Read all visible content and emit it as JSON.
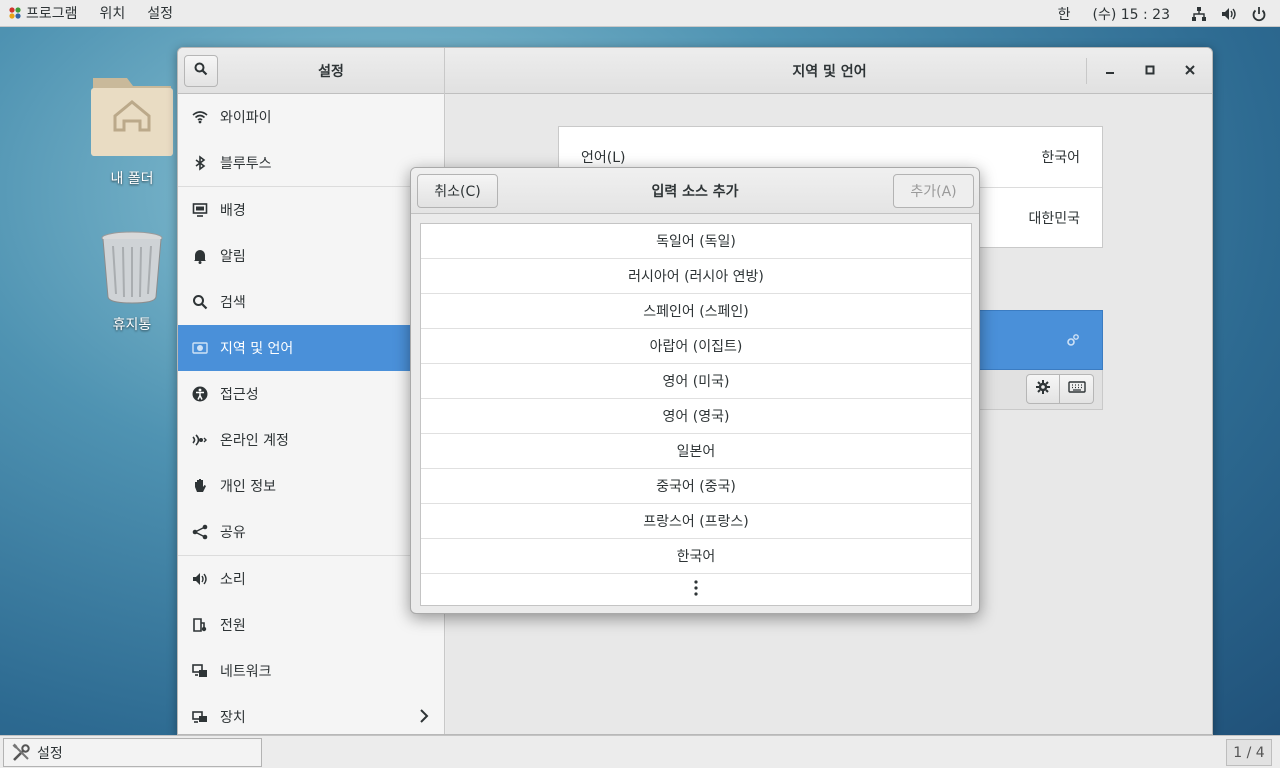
{
  "topbar": {
    "apps_label": "프로그램",
    "places_label": "위치",
    "settings_label": "설정",
    "input_method": "한",
    "clock": "(수) 15 : 23"
  },
  "desktop": {
    "home_label": "내 폴더",
    "trash_label": "휴지통"
  },
  "window": {
    "sidebar_title": "설정",
    "title": "지역 및 언어"
  },
  "sidebar": {
    "items": [
      {
        "label": "와이파이",
        "icon": "wifi-icon"
      },
      {
        "label": "블루투스",
        "icon": "bluetooth-icon"
      },
      {
        "label": "배경",
        "icon": "background-icon"
      },
      {
        "label": "알림",
        "icon": "bell-icon"
      },
      {
        "label": "검색",
        "icon": "search-icon"
      },
      {
        "label": "지역 및 언어",
        "icon": "region-icon"
      },
      {
        "label": "접근성",
        "icon": "accessibility-icon"
      },
      {
        "label": "온라인 계정",
        "icon": "online-accounts-icon"
      },
      {
        "label": "개인 정보",
        "icon": "privacy-icon"
      },
      {
        "label": "공유",
        "icon": "share-icon"
      },
      {
        "label": "소리",
        "icon": "sound-icon"
      },
      {
        "label": "전원",
        "icon": "power-icon"
      },
      {
        "label": "네트워크",
        "icon": "network-icon"
      },
      {
        "label": "장치",
        "icon": "devices-icon"
      }
    ]
  },
  "main": {
    "language_label": "언어(L)",
    "language_value": "한국어",
    "formats_value": "대한민국"
  },
  "dialog": {
    "cancel_label": "취소(C)",
    "title": "입력 소스 추가",
    "add_label": "추가(A)",
    "options": [
      "독일어 (독일)",
      "러시아어 (러시아 연방)",
      "스페인어 (스페인)",
      "아랍어 (이집트)",
      "영어 (미국)",
      "영어 (영국)",
      "일본어",
      "중국어 (중국)",
      "프랑스어 (프랑스)",
      "한국어"
    ]
  },
  "taskbar": {
    "task_label": "설정",
    "workspace": "1 / 4"
  },
  "colors": {
    "accent": "#4a90d9"
  }
}
